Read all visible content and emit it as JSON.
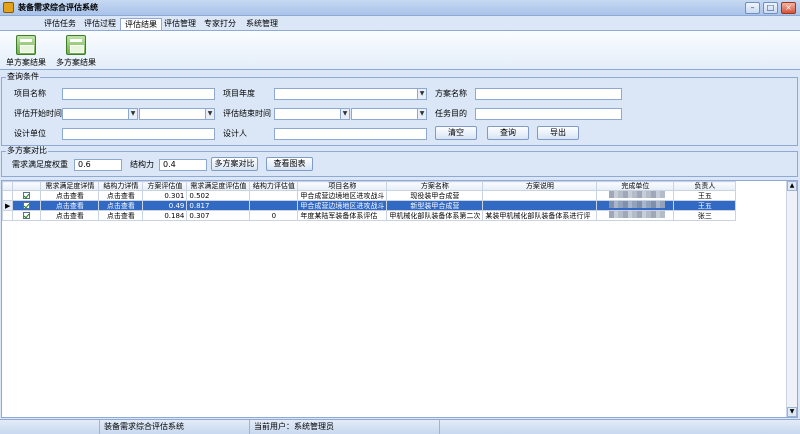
{
  "window": {
    "title": "装备需求综合评估系统",
    "minimize": "–",
    "maximize": "□",
    "close": "×"
  },
  "tabs": [
    "评估任务",
    "评估过程",
    "评估结果",
    "评估管理",
    "专家打分",
    "系统管理"
  ],
  "active_tab": "评估结果",
  "ribbon": {
    "single_label": "单方案结果",
    "multi_label": "多方案结果"
  },
  "query": {
    "group_title": "查询条件",
    "project_name_label": "项目名称",
    "project_year_label": "项目年度",
    "plan_name_label": "方案名称",
    "start_time_label": "评估开始时间",
    "end_time_label": "评估结束时间",
    "task_goal_label": "任务目的",
    "design_unit_label": "设计单位",
    "designer_label": "设计人",
    "clear_label": "清空",
    "search_label": "查询",
    "export_label": "导出"
  },
  "compare": {
    "group_title": "多方案对比",
    "weight_label": "需求满足度权重",
    "weight_value": "0.6",
    "structure_label": "结构力",
    "structure_value": "0.4",
    "compare_label": "多方案对比",
    "chart_label": "查看图表"
  },
  "grid": {
    "columns": [
      "需求满足度详情",
      "结构力详情",
      "方案评估值",
      "需求满足度评估值",
      "结构力评估值",
      "项目名称",
      "方案名称",
      "方案说明",
      "完成单位",
      "负责人"
    ],
    "rows": [
      {
        "checked": true,
        "selected": false,
        "detail1": "点击查看",
        "detail2": "点击查看",
        "plan_value": "0.301",
        "demand_value": "0.502",
        "struct_value": "",
        "project": "甲合成营边境地区进攻战斗",
        "plan": "现役装甲合成营",
        "desc": "",
        "owner": "王五"
      },
      {
        "checked": true,
        "selected": true,
        "detail1": "点击查看",
        "detail2": "点击查看",
        "plan_value": "0.49",
        "demand_value": "0.817",
        "struct_value": "",
        "project": "甲合成营边境地区进攻战斗",
        "plan": "新型装甲合成营",
        "desc": "",
        "owner": "王五"
      },
      {
        "checked": true,
        "selected": false,
        "detail1": "点击查看",
        "detail2": "点击查看",
        "plan_value": "0.184",
        "demand_value": "0.307",
        "struct_value": "0",
        "project": "年度某陆军装备体系评估",
        "plan": "甲机械化部队装备体系第二次",
        "desc": "某装甲机械化部队装备体系进行评",
        "owner": "张三"
      }
    ]
  },
  "status": {
    "app_name": "装备需求综合评估系统",
    "current_user": "当前用户：系统管理员"
  }
}
